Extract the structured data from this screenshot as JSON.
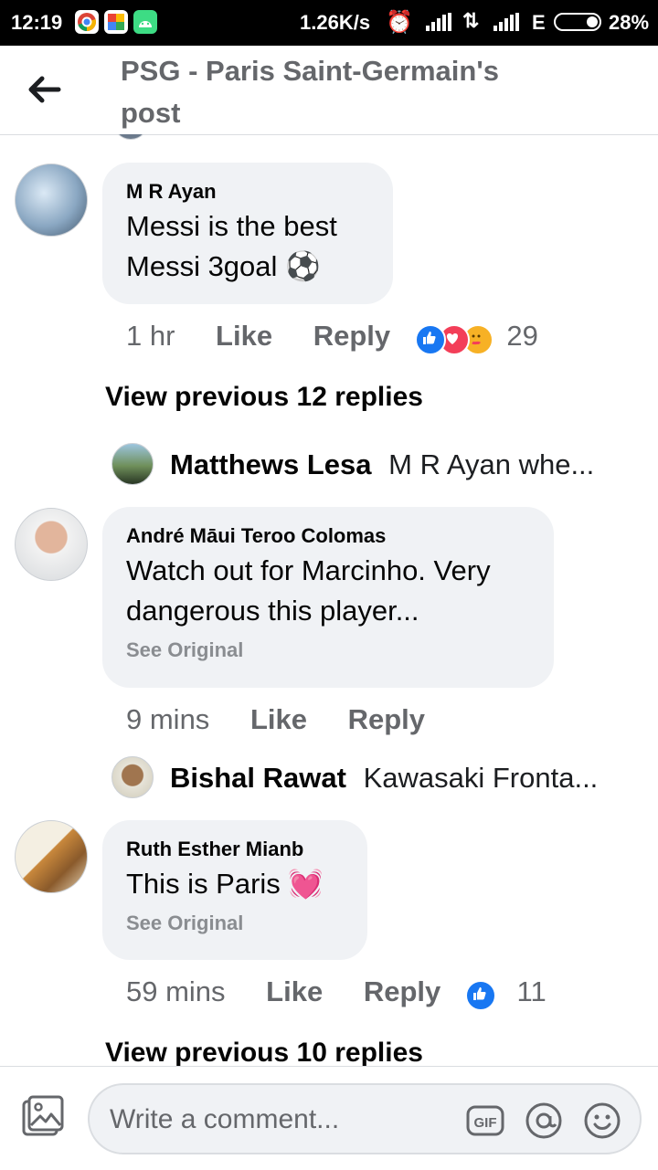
{
  "status_bar": {
    "time": "12:19",
    "speed": "1.26K/s",
    "network": "E",
    "battery": "28%"
  },
  "header": {
    "title": "PSG - Paris Saint-Germain's post"
  },
  "comments": [
    {
      "name": "M R Ayan",
      "text_line1": "Messi is the best",
      "text_line2": "Messi 3goal ⚽",
      "time": "1 hr",
      "like": "Like",
      "reply": "Reply",
      "reaction_count": "29",
      "reactions": [
        "like",
        "love",
        "care"
      ]
    },
    {
      "name": "André Māui Teroo Colomas",
      "text_line1": "Watch out for Marcinho. Very",
      "text_line2": "dangerous this player...",
      "see_original": "See Original",
      "time": "9 mins",
      "like": "Like",
      "reply": "Reply"
    },
    {
      "name": "Ruth Esther Mianb",
      "text_line1": "This is Paris 💓",
      "see_original": "See Original",
      "time": "59 mins",
      "like": "Like",
      "reply": "Reply",
      "reaction_count": "11",
      "reactions": [
        "like"
      ]
    }
  ],
  "view_previous": [
    "View previous 12 replies",
    "View previous 10 replies"
  ],
  "reply_previews": [
    {
      "name": "Matthews Lesa",
      "text": "M R Ayan whe..."
    },
    {
      "name": "Bishal Rawat",
      "text": "Kawasaki Fronta..."
    }
  ],
  "composer": {
    "placeholder": "Write a comment...",
    "gif_label": "GIF"
  },
  "colors": {
    "bubble": "#f0f2f5",
    "meta_text": "#65676b",
    "like_blue": "#1877f2",
    "love_red": "#f33e58",
    "care_yellow": "#f7b125"
  },
  "icons": [
    "back-arrow-icon",
    "photo-icon",
    "gif-icon",
    "mention-icon",
    "emoji-icon",
    "alarm-icon",
    "like-reaction-icon",
    "love-reaction-icon",
    "care-reaction-icon"
  ]
}
